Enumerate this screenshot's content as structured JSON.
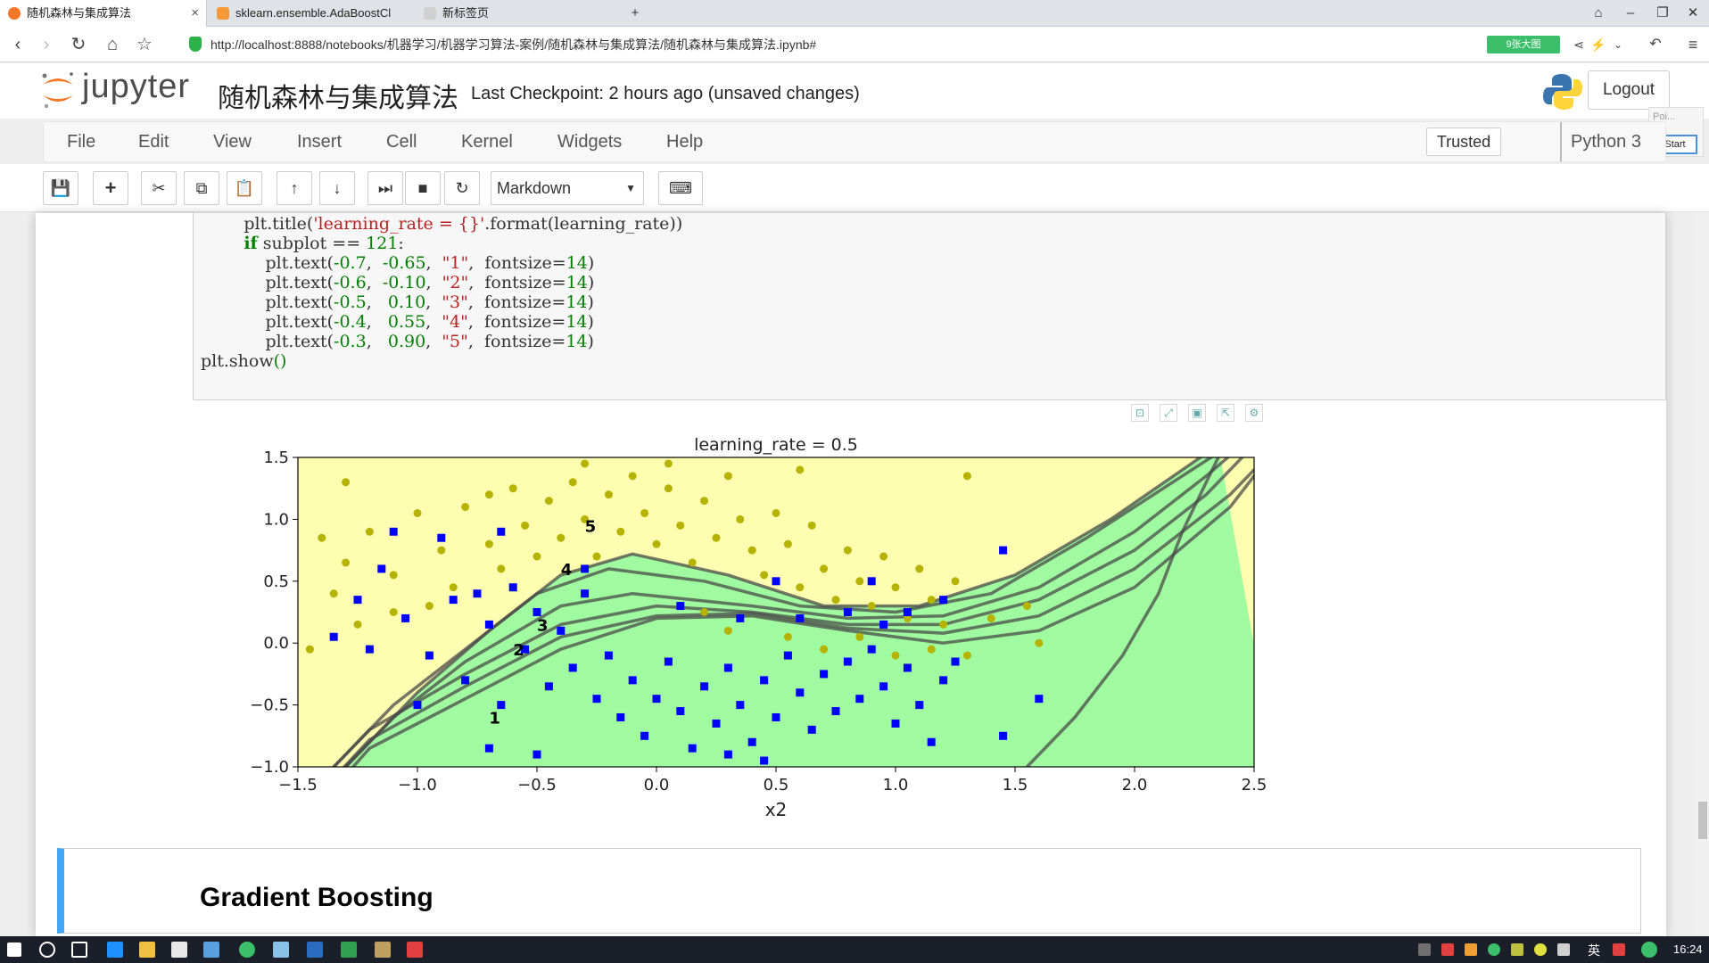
{
  "browser": {
    "tabs": [
      {
        "title": "随机森林与集成算法"
      },
      {
        "title": "sklearn.ensemble.AdaBoostCl"
      },
      {
        "title": "新标签页"
      }
    ],
    "url_host": "http://localhost",
    "url_rest": ":8888/notebooks/机器学习/机器学习算法-案例/随机森林与集成算法/随机森林与集成算法.ipynb#",
    "big_pic_label": "9张大图"
  },
  "jupyter": {
    "logo_text": "jupyter",
    "notebook_name": "随机森林与集成算法",
    "checkpoint": "Last Checkpoint: 2 hours ago (unsaved changes)",
    "logout": "Logout",
    "panel_title": "Poi...",
    "panel_start": "Start"
  },
  "menu": {
    "items": [
      "File",
      "Edit",
      "View",
      "Insert",
      "Cell",
      "Kernel",
      "Widgets",
      "Help"
    ],
    "trusted": "Trusted",
    "kernel": "Python 3"
  },
  "toolbar": {
    "cell_type": "Markdown"
  },
  "code": {
    "lines": [
      {
        "indent": "        ",
        "parts": [
          [
            "plt.title(",
            ""
          ],
          [
            "'learning_rate = {}'",
            "str"
          ],
          [
            ".format(learning_rate))",
            ""
          ]
        ]
      },
      {
        "indent": "        ",
        "parts": [
          [
            "if",
            "kw"
          ],
          [
            " subplot == ",
            ""
          ],
          [
            "121",
            "num"
          ],
          [
            ":",
            ""
          ]
        ]
      },
      {
        "indent": "            ",
        "parts": [
          [
            "plt.text(",
            ""
          ],
          [
            "-0.7",
            "num"
          ],
          [
            ",  ",
            ""
          ],
          [
            "-0.65",
            "num"
          ],
          [
            ",  ",
            ""
          ],
          [
            "\"1\"",
            "str"
          ],
          [
            ",  fontsize=",
            ""
          ],
          [
            "14",
            "num"
          ],
          [
            ")",
            ""
          ]
        ]
      },
      {
        "indent": "            ",
        "parts": [
          [
            "plt.text(",
            ""
          ],
          [
            "-0.6",
            "num"
          ],
          [
            ",  ",
            ""
          ],
          [
            "-0.10",
            "num"
          ],
          [
            ",  ",
            ""
          ],
          [
            "\"2\"",
            "str"
          ],
          [
            ",  fontsize=",
            ""
          ],
          [
            "14",
            "num"
          ],
          [
            ")",
            ""
          ]
        ]
      },
      {
        "indent": "            ",
        "parts": [
          [
            "plt.text(",
            ""
          ],
          [
            "-0.5",
            "num"
          ],
          [
            ",   ",
            ""
          ],
          [
            "0.10",
            "num"
          ],
          [
            ",  ",
            ""
          ],
          [
            "\"3\"",
            "str"
          ],
          [
            ",  fontsize=",
            ""
          ],
          [
            "14",
            "num"
          ],
          [
            ")",
            ""
          ]
        ]
      },
      {
        "indent": "            ",
        "parts": [
          [
            "plt.text(",
            ""
          ],
          [
            "-0.4",
            "num"
          ],
          [
            ",   ",
            ""
          ],
          [
            "0.55",
            "num"
          ],
          [
            ",  ",
            ""
          ],
          [
            "\"4\"",
            "str"
          ],
          [
            ",  fontsize=",
            ""
          ],
          [
            "14",
            "num"
          ],
          [
            ")",
            ""
          ]
        ]
      },
      {
        "indent": "            ",
        "parts": [
          [
            "plt.text(",
            ""
          ],
          [
            "-0.3",
            "num"
          ],
          [
            ",   ",
            ""
          ],
          [
            "0.90",
            "num"
          ],
          [
            ",  ",
            ""
          ],
          [
            "\"5\"",
            "str"
          ],
          [
            ",  fontsize=",
            ""
          ],
          [
            "14",
            "num"
          ],
          [
            ")",
            ""
          ]
        ]
      },
      {
        "indent": "",
        "parts": [
          [
            "plt.show",
            ""
          ],
          [
            "()",
            "num"
          ]
        ]
      }
    ]
  },
  "markdown": {
    "heading": "Gradient Boosting"
  },
  "taskbar": {
    "time": "16:24",
    "lang": "英"
  },
  "chart_data": {
    "type": "scatter",
    "title": "learning_rate = 0.5",
    "xlabel": "x2",
    "ylabel": "",
    "xlim": [
      -1.5,
      2.5
    ],
    "ylim": [
      -1.0,
      1.5
    ],
    "xticks": [
      "−1.5",
      "−1.0",
      "−0.5",
      "0.0",
      "0.5",
      "1.0",
      "1.5",
      "2.0",
      "2.5"
    ],
    "yticks": [
      "1.5",
      "1.0",
      "0.5",
      "0.0",
      "−0.5",
      "−1.0"
    ],
    "colors": {
      "region_top": "#fefeb0",
      "region_bottom": "#a0fa9f",
      "class0": "#b6b200",
      "class1": "#0000ff",
      "boundary": "#4a4a4a"
    },
    "annotations": [
      {
        "text": "1",
        "x": -0.7,
        "y": -0.65
      },
      {
        "text": "2",
        "x": -0.6,
        "y": -0.1
      },
      {
        "text": "3",
        "x": -0.5,
        "y": 0.1
      },
      {
        "text": "4",
        "x": -0.4,
        "y": 0.55
      },
      {
        "text": "5",
        "x": -0.3,
        "y": 0.9
      }
    ],
    "boundary_curves": [
      {
        "name": "",
        "points": [
          [
            -1.5,
            -1.5
          ],
          [
            -1.2,
            -0.85
          ],
          [
            -0.8,
            -0.45
          ],
          [
            -0.4,
            -0.05
          ],
          [
            0.0,
            0.2
          ],
          [
            0.4,
            0.22
          ],
          [
            0.8,
            0.1
          ],
          [
            1.2,
            0.0
          ],
          [
            1.6,
            0.1
          ],
          [
            2.0,
            0.45
          ],
          [
            2.4,
            1.1
          ],
          [
            2.6,
            1.6
          ]
        ]
      },
      {
        "name": "",
        "points": [
          [
            -1.5,
            -1.4
          ],
          [
            -1.2,
            -0.78
          ],
          [
            -0.8,
            -0.35
          ],
          [
            -0.4,
            0.05
          ],
          [
            0.0,
            0.22
          ],
          [
            0.4,
            0.24
          ],
          [
            0.8,
            0.12
          ],
          [
            1.2,
            0.08
          ],
          [
            1.6,
            0.22
          ],
          [
            2.0,
            0.6
          ],
          [
            2.4,
            1.2
          ],
          [
            2.6,
            1.6
          ]
        ]
      },
      {
        "name": "",
        "points": [
          [
            -1.5,
            -1.3
          ],
          [
            -1.2,
            -0.7
          ],
          [
            -0.8,
            -0.25
          ],
          [
            -0.4,
            0.15
          ],
          [
            0.0,
            0.3
          ],
          [
            0.4,
            0.25
          ],
          [
            0.8,
            0.15
          ],
          [
            1.2,
            0.15
          ],
          [
            1.6,
            0.35
          ],
          [
            2.0,
            0.75
          ],
          [
            2.3,
            1.2
          ],
          [
            2.5,
            1.6
          ]
        ]
      },
      {
        "name": "",
        "points": [
          [
            -1.4,
            -1.2
          ],
          [
            -1.1,
            -0.6
          ],
          [
            -0.8,
            -0.15
          ],
          [
            -0.4,
            0.3
          ],
          [
            -0.1,
            0.4
          ],
          [
            0.4,
            0.3
          ],
          [
            0.8,
            0.2
          ],
          [
            1.2,
            0.22
          ],
          [
            1.6,
            0.45
          ],
          [
            2.0,
            0.9
          ],
          [
            2.3,
            1.35
          ],
          [
            2.45,
            1.6
          ]
        ]
      },
      {
        "name": "",
        "points": [
          [
            -1.4,
            -1.1
          ],
          [
            -1.1,
            -0.5
          ],
          [
            -0.8,
            -0.05
          ],
          [
            -0.5,
            0.4
          ],
          [
            -0.2,
            0.6
          ],
          [
            0.2,
            0.5
          ],
          [
            0.6,
            0.3
          ],
          [
            1.0,
            0.25
          ],
          [
            1.4,
            0.4
          ],
          [
            1.8,
            0.85
          ],
          [
            2.2,
            1.35
          ],
          [
            2.4,
            1.6
          ]
        ]
      },
      {
        "name": "",
        "points": [
          [
            -1.3,
            -1.0
          ],
          [
            -1.0,
            -0.4
          ],
          [
            -0.7,
            0.1
          ],
          [
            -0.4,
            0.55
          ],
          [
            -0.1,
            0.72
          ],
          [
            0.3,
            0.55
          ],
          [
            0.7,
            0.3
          ],
          [
            1.1,
            0.3
          ],
          [
            1.5,
            0.55
          ],
          [
            1.9,
            1.0
          ],
          [
            2.2,
            1.4
          ],
          [
            2.35,
            1.6
          ]
        ]
      },
      {
        "name": "",
        "points": [
          [
            1.55,
            -1.0
          ],
          [
            1.75,
            -0.6
          ],
          [
            1.95,
            -0.1
          ],
          [
            2.1,
            0.4
          ],
          [
            2.2,
            0.9
          ],
          [
            2.35,
            1.5
          ]
        ]
      }
    ],
    "series": [
      {
        "name": "",
        "marker": "circle",
        "points": [
          [
            -1.4,
            0.85
          ],
          [
            -1.3,
            0.65
          ],
          [
            -1.35,
            0.4
          ],
          [
            -1.2,
            0.9
          ],
          [
            -1.1,
            0.55
          ],
          [
            -1.0,
            1.05
          ],
          [
            -0.9,
            0.75
          ],
          [
            -0.85,
            0.45
          ],
          [
            -0.8,
            1.1
          ],
          [
            -0.7,
            0.8
          ],
          [
            -0.65,
            0.6
          ],
          [
            -0.6,
            1.25
          ],
          [
            -0.55,
            0.95
          ],
          [
            -0.5,
            0.7
          ],
          [
            -0.45,
            1.15
          ],
          [
            -0.4,
            0.85
          ],
          [
            -0.35,
            1.3
          ],
          [
            -0.3,
            1.0
          ],
          [
            -0.25,
            0.7
          ],
          [
            -0.2,
            1.2
          ],
          [
            -0.15,
            0.9
          ],
          [
            -0.1,
            1.35
          ],
          [
            -0.05,
            1.05
          ],
          [
            0.0,
            0.8
          ],
          [
            0.05,
            1.25
          ],
          [
            0.1,
            0.95
          ],
          [
            0.15,
            0.65
          ],
          [
            0.2,
            1.15
          ],
          [
            0.25,
            0.85
          ],
          [
            0.3,
            1.35
          ],
          [
            0.35,
            1.0
          ],
          [
            0.4,
            0.75
          ],
          [
            0.45,
            0.55
          ],
          [
            0.5,
            1.05
          ],
          [
            0.55,
            0.8
          ],
          [
            0.6,
            0.45
          ],
          [
            0.65,
            0.95
          ],
          [
            0.7,
            0.6
          ],
          [
            0.75,
            0.35
          ],
          [
            0.8,
            0.75
          ],
          [
            0.85,
            0.5
          ],
          [
            0.9,
            0.3
          ],
          [
            0.95,
            0.7
          ],
          [
            1.0,
            0.45
          ],
          [
            1.05,
            0.2
          ],
          [
            1.1,
            0.6
          ],
          [
            1.15,
            0.35
          ],
          [
            1.2,
            0.15
          ],
          [
            1.25,
            0.5
          ],
          [
            1.3,
            1.35
          ],
          [
            -1.25,
            0.15
          ],
          [
            -1.45,
            -0.05
          ],
          [
            -1.1,
            0.25
          ],
          [
            -0.95,
            0.3
          ],
          [
            0.3,
            0.1
          ],
          [
            0.55,
            0.05
          ],
          [
            0.7,
            -0.05
          ],
          [
            0.85,
            0.05
          ],
          [
            1.0,
            -0.1
          ],
          [
            1.15,
            -0.05
          ],
          [
            1.3,
            -0.1
          ],
          [
            1.4,
            0.2
          ],
          [
            1.55,
            0.3
          ],
          [
            1.6,
            0.0
          ],
          [
            0.2,
            0.25
          ],
          [
            -0.3,
            1.45
          ],
          [
            0.6,
            1.4
          ],
          [
            -0.7,
            1.2
          ],
          [
            -1.3,
            1.3
          ],
          [
            0.05,
            1.45
          ]
        ]
      },
      {
        "name": "",
        "marker": "square",
        "points": [
          [
            -1.35,
            0.05
          ],
          [
            -1.25,
            0.35
          ],
          [
            -1.15,
            0.6
          ],
          [
            -1.05,
            0.2
          ],
          [
            -0.95,
            -0.1
          ],
          [
            -0.9,
            0.85
          ],
          [
            -0.8,
            -0.3
          ],
          [
            -0.75,
            0.4
          ],
          [
            -0.7,
            0.15
          ],
          [
            -0.65,
            -0.5
          ],
          [
            -0.6,
            0.45
          ],
          [
            -0.55,
            -0.05
          ],
          [
            -0.5,
            0.25
          ],
          [
            -0.45,
            -0.35
          ],
          [
            -0.4,
            0.1
          ],
          [
            -0.35,
            -0.2
          ],
          [
            -0.3,
            0.4
          ],
          [
            -0.25,
            -0.45
          ],
          [
            -0.2,
            -0.1
          ],
          [
            -0.15,
            -0.6
          ],
          [
            -0.1,
            -0.3
          ],
          [
            -0.05,
            -0.75
          ],
          [
            0.0,
            -0.45
          ],
          [
            0.05,
            -0.15
          ],
          [
            0.1,
            -0.55
          ],
          [
            0.15,
            -0.85
          ],
          [
            0.2,
            -0.35
          ],
          [
            0.25,
            -0.65
          ],
          [
            0.3,
            -0.2
          ],
          [
            0.35,
            -0.5
          ],
          [
            0.4,
            -0.8
          ],
          [
            0.45,
            -0.3
          ],
          [
            0.5,
            -0.6
          ],
          [
            0.55,
            -0.1
          ],
          [
            0.6,
            -0.4
          ],
          [
            0.65,
            -0.7
          ],
          [
            0.7,
            -0.25
          ],
          [
            0.75,
            -0.55
          ],
          [
            0.8,
            -0.15
          ],
          [
            0.85,
            -0.45
          ],
          [
            0.9,
            -0.05
          ],
          [
            0.95,
            -0.35
          ],
          [
            1.0,
            -0.65
          ],
          [
            1.05,
            -0.2
          ],
          [
            1.1,
            -0.5
          ],
          [
            1.15,
            -0.8
          ],
          [
            1.2,
            -0.3
          ],
          [
            1.25,
            -0.15
          ],
          [
            0.45,
            -0.95
          ],
          [
            0.95,
            0.15
          ],
          [
            1.2,
            0.35
          ],
          [
            1.45,
            0.75
          ],
          [
            1.6,
            -0.45
          ],
          [
            1.45,
            -0.75
          ],
          [
            -0.3,
            0.6
          ],
          [
            -0.85,
            0.35
          ],
          [
            -1.1,
            0.9
          ],
          [
            -0.65,
            0.9
          ],
          [
            0.1,
            0.3
          ],
          [
            0.35,
            0.2
          ],
          [
            0.6,
            0.2
          ],
          [
            0.8,
            0.25
          ],
          [
            1.05,
            0.25
          ],
          [
            -1.2,
            -0.05
          ],
          [
            -1.0,
            -0.5
          ],
          [
            -0.7,
            -0.85
          ],
          [
            -0.5,
            -0.9
          ],
          [
            0.3,
            -0.9
          ],
          [
            0.5,
            0.5
          ],
          [
            0.9,
            0.5
          ]
        ]
      }
    ]
  }
}
